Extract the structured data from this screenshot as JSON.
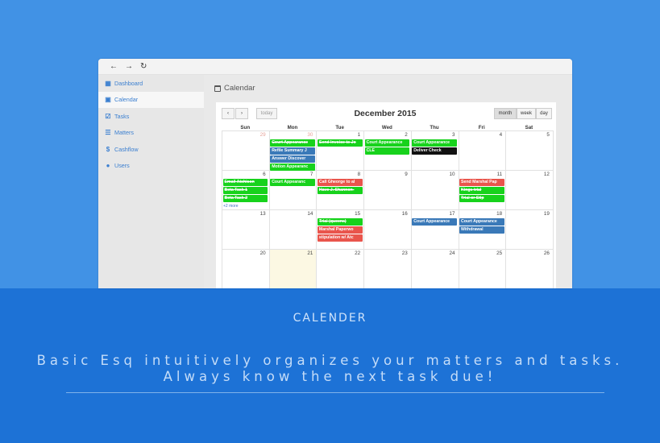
{
  "browser": {
    "back": "←",
    "forward": "→",
    "reload": "↻"
  },
  "sidebar": {
    "items": [
      {
        "label": "Dashboard",
        "icon": "dashboard-icon",
        "active": false
      },
      {
        "label": "Calendar",
        "icon": "calendar-icon",
        "active": true
      },
      {
        "label": "Tasks",
        "icon": "checkbox-icon",
        "active": false
      },
      {
        "label": "Matters",
        "icon": "list-icon",
        "active": false
      },
      {
        "label": "Cashflow",
        "icon": "dollar-icon",
        "active": false
      },
      {
        "label": "Users",
        "icon": "user-icon",
        "active": false
      }
    ]
  },
  "page": {
    "title": "Calendar"
  },
  "calendar": {
    "title": "December 2015",
    "prev": "‹",
    "next": "›",
    "today": "today",
    "views": [
      "month",
      "week",
      "day"
    ],
    "active_view": "month",
    "dow": [
      "Sun",
      "Mon",
      "Tue",
      "Wed",
      "Thu",
      "Fri",
      "Sat"
    ],
    "weeks": [
      [
        29,
        30,
        1,
        2,
        3,
        4,
        5
      ],
      [
        6,
        7,
        8,
        9,
        10,
        11,
        12
      ],
      [
        13,
        14,
        15,
        16,
        17,
        18,
        19
      ],
      [
        20,
        21,
        22,
        23,
        24,
        25,
        26
      ]
    ],
    "colors": {
      "green": "#17d21c",
      "blue": "#3a79b8",
      "red": "#e9554c",
      "black": "#111111",
      "today_bg": "#fcf8e3"
    },
    "events": [
      {
        "week": 0,
        "col": 1,
        "span": 1,
        "row": 0,
        "text": "Court Appearance",
        "color": "green",
        "strike": true
      },
      {
        "week": 0,
        "col": 1,
        "span": 1,
        "row": 1,
        "text": "Refile Summary J",
        "color": "blue",
        "strike": false
      },
      {
        "week": 0,
        "col": 1,
        "span": 1,
        "row": 2,
        "text": "Answer Discover",
        "color": "blue",
        "strike": false
      },
      {
        "week": 0,
        "col": 1,
        "span": 1,
        "row": 3,
        "text": "Motion Appearanc",
        "color": "green",
        "strike": false
      },
      {
        "week": 0,
        "col": 2,
        "span": 1,
        "row": 0,
        "text": "Send Invoice to Jo",
        "color": "green",
        "strike": true
      },
      {
        "week": 0,
        "col": 3,
        "span": 1,
        "row": 0,
        "text": "Court Appearance",
        "color": "green",
        "strike": false
      },
      {
        "week": 0,
        "col": 3,
        "span": 1,
        "row": 1,
        "text": "CLE",
        "color": "green",
        "strike": false
      },
      {
        "week": 0,
        "col": 4,
        "span": 1,
        "row": 0,
        "text": "Court Appearance",
        "color": "green",
        "strike": false
      },
      {
        "week": 0,
        "col": 4,
        "span": 1,
        "row": 1,
        "text": "Deliver Check",
        "color": "black",
        "strike": false
      },
      {
        "week": 1,
        "col": 0,
        "span": 1,
        "row": 0,
        "text": "Email Atchison",
        "color": "green",
        "strike": true
      },
      {
        "week": 1,
        "col": 0,
        "span": 1,
        "row": 1,
        "text": "Beta Task 1",
        "color": "green",
        "strike": true
      },
      {
        "week": 1,
        "col": 0,
        "span": 1,
        "row": 2,
        "text": "Beta Task 2",
        "color": "green",
        "strike": true
      },
      {
        "week": 1,
        "col": 1,
        "span": 1,
        "row": 0,
        "text": "Court Appearanc",
        "color": "green",
        "strike": false
      },
      {
        "week": 1,
        "col": 2,
        "span": 1,
        "row": 0,
        "text": "Call Gheorge to al",
        "color": "red",
        "strike": false
      },
      {
        "week": 1,
        "col": 2,
        "span": 1,
        "row": 1,
        "text": "Have J. Shannon-",
        "color": "green",
        "strike": true
      },
      {
        "week": 1,
        "col": 5,
        "span": 1,
        "row": 0,
        "text": "Send Marshal Pap",
        "color": "red",
        "strike": false
      },
      {
        "week": 1,
        "col": 5,
        "span": 1,
        "row": 1,
        "text": "Kings trial",
        "color": "green",
        "strike": true
      },
      {
        "week": 1,
        "col": 5,
        "span": 1,
        "row": 2,
        "text": "Trial or Stip",
        "color": "green",
        "strike": true
      },
      {
        "week": 2,
        "col": 2,
        "span": 1,
        "row": 0,
        "text": "Trial (queens)",
        "color": "green",
        "strike": true
      },
      {
        "week": 2,
        "col": 2,
        "span": 1,
        "row": 1,
        "text": "Marshal Paperwo",
        "color": "red",
        "strike": false
      },
      {
        "week": 2,
        "col": 2,
        "span": 1,
        "row": 2,
        "text": "stipulation w/ Atc",
        "color": "red",
        "strike": false
      },
      {
        "week": 2,
        "col": 4,
        "span": 1,
        "row": 0,
        "text": "Court Appearance",
        "color": "blue",
        "strike": false
      },
      {
        "week": 2,
        "col": 5,
        "span": 1,
        "row": 0,
        "text": "Court Appearance",
        "color": "blue",
        "strike": false
      },
      {
        "week": 2,
        "col": 5,
        "span": 1,
        "row": 1,
        "text": "Withdrawal",
        "color": "blue",
        "strike": false
      }
    ],
    "more_links": [
      {
        "week": 1,
        "col": 0,
        "text": "+2 more"
      }
    ],
    "fab": "+"
  },
  "promo": {
    "heading": "CALENDER",
    "line1": "Basic Esq intuitively organizes your matters and tasks.",
    "line2": "Always know the next task due!"
  }
}
